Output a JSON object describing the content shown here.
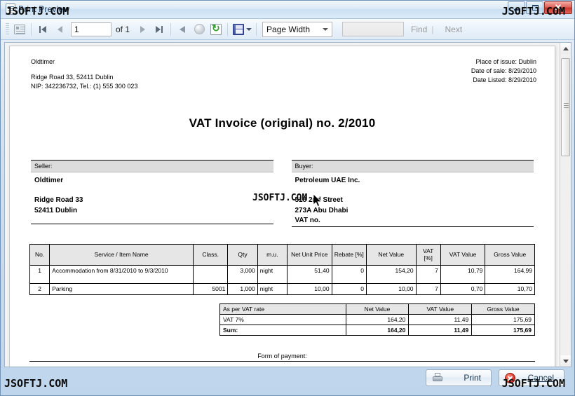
{
  "window": {
    "title": "Print Preview",
    "icon": "document-preview-icon",
    "buttons": {
      "minimize": "–",
      "maximize": "□",
      "close": "✕"
    }
  },
  "toolbar": {
    "page_list_icon": "page-list-icon",
    "first_page_label": "First Page",
    "prev_page_label": "Previous Page",
    "page_value": "1",
    "of_label": "of 1",
    "next_page_label": "Next Page",
    "last_page_label": "Last Page",
    "back_label": "Back",
    "stop_label": "Stop",
    "refresh_label": "Refresh",
    "export_label": "Save / Export",
    "zoom_value": "Page Width",
    "find_placeholder": "",
    "find_value": "",
    "find_label": "Find",
    "divider": "|",
    "next_label": "Next"
  },
  "footer": {
    "print_label": "Print",
    "cancel_label": "Cancel"
  },
  "invoice": {
    "from": {
      "company": "Oldtimer",
      "address": "Ridge Road 33, 52411 Dublin",
      "tax_phone": "NIP: 342236732, Tel.: (1) 555 300 023"
    },
    "meta": {
      "place_of_issue": "Place of issue: Dublin",
      "date_of_sale": "Date of sale: 8/29/2010",
      "date_listed": "Date Listed: 8/29/2010"
    },
    "title": "VAT Invoice (original) no.  2/2010",
    "seller": {
      "header": "Seller:",
      "name": "Oldtimer",
      "line1": "Ridge Road 33",
      "line2": "52411  Dublin"
    },
    "buyer": {
      "header": "Buyer:",
      "name": "Petroleum UAE Inc.",
      "line1": "518 2nd Street",
      "line2": "273A Abu Dhabi",
      "line3": "VAT no."
    },
    "items_table": {
      "columns": [
        "No.",
        "Service / Item Name",
        "Class.",
        "Qty",
        "m.u.",
        "Net Unit Price",
        "Rebate [%]",
        "Net Value",
        "VAT [%]",
        "VAT Value",
        "Gross Value"
      ],
      "rows": [
        {
          "no": "1",
          "name": "Accommodation from 8/31/2010 to 9/3/2010",
          "class": "",
          "qty": "3,000",
          "mu": "night",
          "net_unit_price": "51,40",
          "rebate": "0",
          "net_value": "154,20",
          "vat_pct": "7",
          "vat_value": "10,79",
          "gross_value": "164,99"
        },
        {
          "no": "2",
          "name": "Parking",
          "class": "5001",
          "qty": "1,000",
          "mu": "night",
          "net_unit_price": "10,00",
          "rebate": "0",
          "net_value": "10,00",
          "vat_pct": "7",
          "vat_value": "0,70",
          "gross_value": "10,70"
        }
      ]
    },
    "vat_table": {
      "columns": [
        "As per VAT rate",
        "Net Value",
        "VAT Value",
        "Gross Value"
      ],
      "rows": [
        {
          "label": "VAT 7%",
          "net_value": "164,20",
          "vat_value": "11,49",
          "gross_value": "175,69"
        }
      ],
      "sum": {
        "label": "Sum:",
        "net_value": "164,20",
        "vat_value": "11,49",
        "gross_value": "175,69"
      }
    },
    "form_of_payment": "Form of payment:"
  },
  "watermark": {
    "text": "JSOFTJ.COM"
  },
  "colors": {
    "title_bar": "#dceaf7",
    "close_button": "#c9352a",
    "table_header": "#e6e6e6",
    "party_header": "#dcdcdc",
    "page_background": "#f3f3f3"
  }
}
